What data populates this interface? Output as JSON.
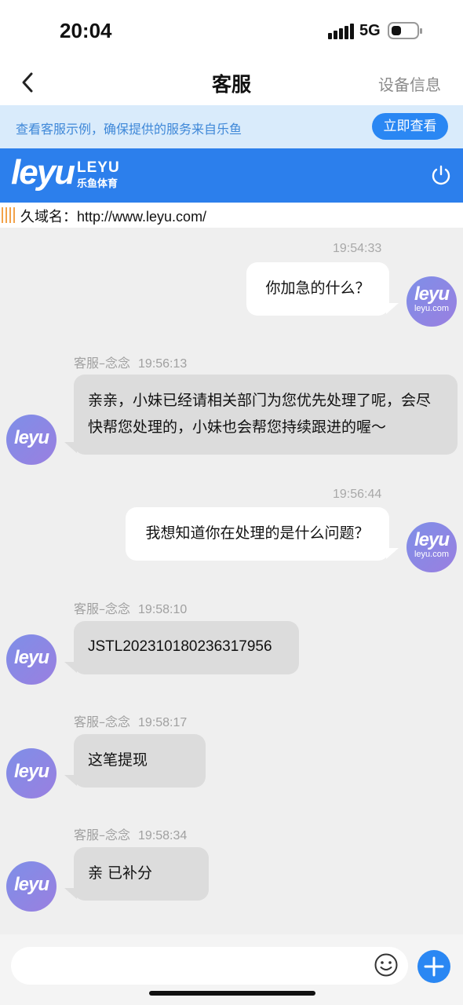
{
  "status_bar": {
    "time": "20:04",
    "network": "5G"
  },
  "nav": {
    "title": "客服",
    "right_label": "设备信息"
  },
  "notice": {
    "text": "查看客服示例，确保提供的服务来自乐鱼",
    "button": "立即查看"
  },
  "brand": {
    "logo": "leyu",
    "name_en": "LEYU",
    "name_cn": "乐鱼体育"
  },
  "domain": {
    "label": "久域名：",
    "url": "http://www.leyu.com/"
  },
  "avatar": {
    "logo": "leyu",
    "site": "leyu.com"
  },
  "messages": [
    {
      "side": "right",
      "time": "19:54:33",
      "text": "你加急的什么？"
    },
    {
      "side": "left",
      "sender": "客服–念念",
      "time": "19:56:13",
      "lines": [
        "亲亲，小妹已经请相关部门为您优先处理了呢，会尽",
        "快帮您处理的，小妹也会帮您持续跟进的喔～"
      ]
    },
    {
      "side": "right",
      "time": "19:56:44",
      "text": "我想知道你在处理的是什么问题？"
    },
    {
      "side": "left",
      "sender": "客服–念念",
      "time": "19:58:10",
      "text": "JSTL202310180236317956"
    },
    {
      "side": "left",
      "sender": "客服–念念",
      "time": "19:58:17",
      "text": "这笔提现"
    },
    {
      "side": "left",
      "sender": "客服–念念",
      "time": "19:58:34",
      "text": "亲 已补分"
    }
  ],
  "input": {
    "placeholder": "",
    "value": ""
  },
  "icons": [
    "back-arrow-icon",
    "signal-icon",
    "battery-icon",
    "power-icon",
    "emoji-icon",
    "plus-icon"
  ],
  "colors": {
    "primary": "#2a87f3",
    "brand_bar": "#2c7fec",
    "notice_bg": "#d9ebfb",
    "agent_bubble": "#dcdcdc",
    "user_bubble": "#ffffff"
  }
}
